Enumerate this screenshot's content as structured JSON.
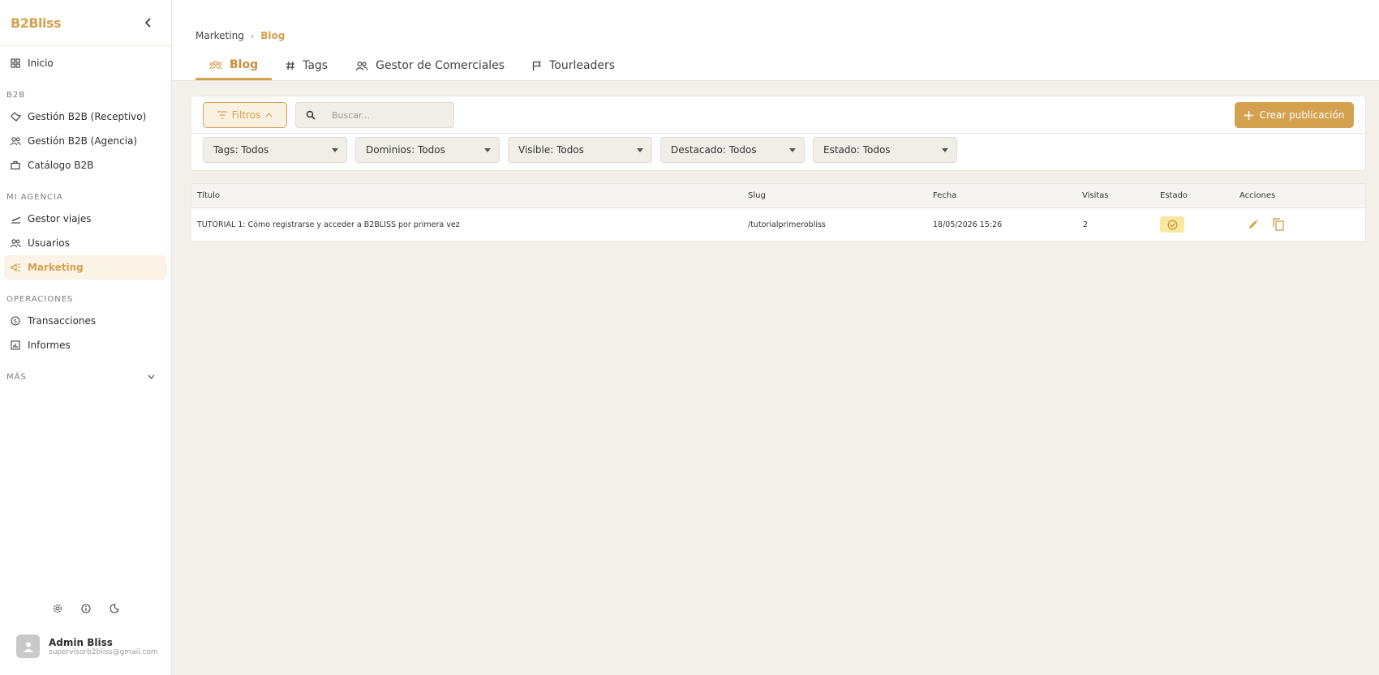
{
  "sidebar": {
    "brand": "B2Bliss",
    "home_label": "Inicio",
    "sections": {
      "b2b": "B2B",
      "mi_agencia": "MI AGENCIA",
      "operaciones": "OPERACIONES",
      "mas": "MÁS"
    },
    "items": {
      "receptivo": "Gestión B2B (Receptivo)",
      "agencia": "Gestión B2B (Agencia)",
      "catalogo": "Catálogo B2B",
      "gestor_viajes": "Gestor viajes",
      "usuarios": "Usuarios",
      "marketing": "Marketing",
      "transacciones": "Transacciones",
      "informes": "Informes"
    },
    "user": {
      "name": "Admin Bliss",
      "email": "supervisorb2bliss@gmail.com"
    }
  },
  "header": {
    "breadcrumb": [
      "Marketing",
      "Blog"
    ],
    "tabs": [
      "Blog",
      "Tags",
      "Gestor de Comerciales",
      "Tourleaders"
    ]
  },
  "toolbar": {
    "filters_label": "Filtros",
    "search_placeholder": "Buscar...",
    "create_label": "Crear publicación",
    "filters": [
      "Tags: Todos",
      "Dominios: Todos",
      "Visible: Todos",
      "Destacado: Todos",
      "Estado: Todos"
    ]
  },
  "table": {
    "columns": [
      "Título",
      "Slug",
      "Fecha",
      "Visitas",
      "Estado",
      "Acciones"
    ],
    "rows": [
      {
        "titulo": "TUTORIAL 1: Cómo registrarse y acceder a B2BLISS por primera vez",
        "slug": "/tutorialprimerobliss",
        "fecha": "18/05/2026 15:26",
        "visitas": "2"
      }
    ]
  },
  "colors": {
    "accent": "#d4a14f",
    "background": "#f3f0ea",
    "status_badge": "#fbe8a0"
  }
}
